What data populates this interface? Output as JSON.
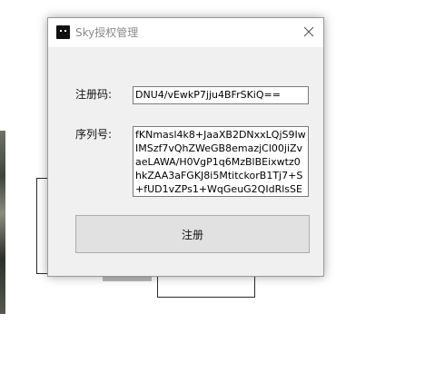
{
  "window": {
    "title": "Sky授权管理",
    "icon": "app-icon",
    "close_icon": "close-icon"
  },
  "form": {
    "reg_code_label": "注册码:",
    "reg_code_value": "DNU4/vEwkP7jju4BFrSKiQ==",
    "serial_label": "序列号:",
    "serial_lines": [
      "fKNmasl4k8+JaaXB2DNxxLQjS9Iw",
      "IMSzf7vQhZWeGB8emazjCl00jiZv",
      "aeLAWA/H0VgP1q6MzBlBEixwtz0",
      "hkZAA3aFGKJ8i5MtitckorB1Tj7+S",
      "+fUD1vZPs1+WqGeuG2QIdRlsSE"
    ],
    "register_button_label": "注册"
  },
  "colors": {
    "dialog_bg": "#f0f0f0",
    "titlebar_bg": "#ffffff",
    "button_bg": "#e1e1e1",
    "title_text": "#8a8a8a"
  }
}
